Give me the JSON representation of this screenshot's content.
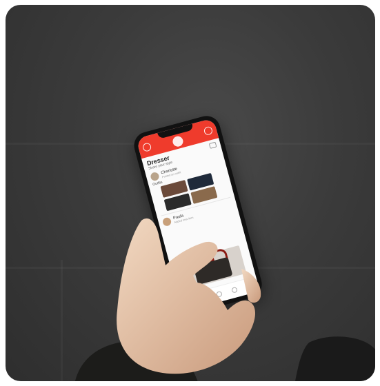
{
  "app": {
    "brand_color": "#ef3b2c",
    "header_icons": [
      "person-icon",
      "logo-icon",
      "gear-icon"
    ]
  },
  "feed": {
    "title": "Dresser",
    "subtitle": "Share your style",
    "post_user": "Charlotte",
    "post_meta": "Posted an outfit",
    "outfit_label": "Outfits",
    "second_user": "Paula",
    "second_meta": "Added new item"
  },
  "bottom_nav": [
    "home-icon",
    "search-icon",
    "add-icon",
    "heart-icon",
    "profile-icon"
  ]
}
